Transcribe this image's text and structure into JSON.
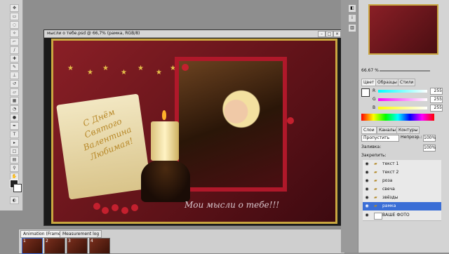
{
  "document": {
    "title": "мысли о тебе.psd @ 66,7% (рамка, RGB/8)",
    "caption": "Мои мысли о тебе!!!",
    "scroll_text": [
      "С Днём",
      "Святого",
      "Валентина",
      "Любимая!"
    ]
  },
  "animation_panel": {
    "tabs": [
      "Animation (Frames)",
      "Measurement log"
    ],
    "frames": [
      "1",
      "2",
      "3",
      "4"
    ]
  },
  "navigator": {
    "zoom": "66.67 %"
  },
  "color_panel": {
    "tabs": [
      "Цвет",
      "Образцы",
      "Стили"
    ],
    "channels": [
      {
        "label": "R",
        "value": "255"
      },
      {
        "label": "G",
        "value": "255"
      },
      {
        "label": "B",
        "value": "255"
      }
    ]
  },
  "layers_panel": {
    "tabs": [
      "Слои",
      "Каналы",
      "Контуры"
    ],
    "blend_mode": "Пропустить",
    "opacity_label": "Непрозр.:",
    "opacity": "100%",
    "lock_label": "Закрепить:",
    "fill_label": "Заливка:",
    "fill": "100%",
    "layers": [
      {
        "name": "текст 1",
        "type": "folder"
      },
      {
        "name": "текст 2",
        "type": "folder"
      },
      {
        "name": "роза",
        "type": "folder"
      },
      {
        "name": "свеча",
        "type": "folder"
      },
      {
        "name": "звёзды",
        "type": "folder"
      },
      {
        "name": "рамка",
        "type": "folder"
      },
      {
        "name": "ВАШЕ ФОТО",
        "type": "layer"
      }
    ]
  },
  "colors": {
    "canvas_bg": "#6e1820",
    "frame_gold": "#c9a640",
    "selection": "#3a6ed6"
  }
}
